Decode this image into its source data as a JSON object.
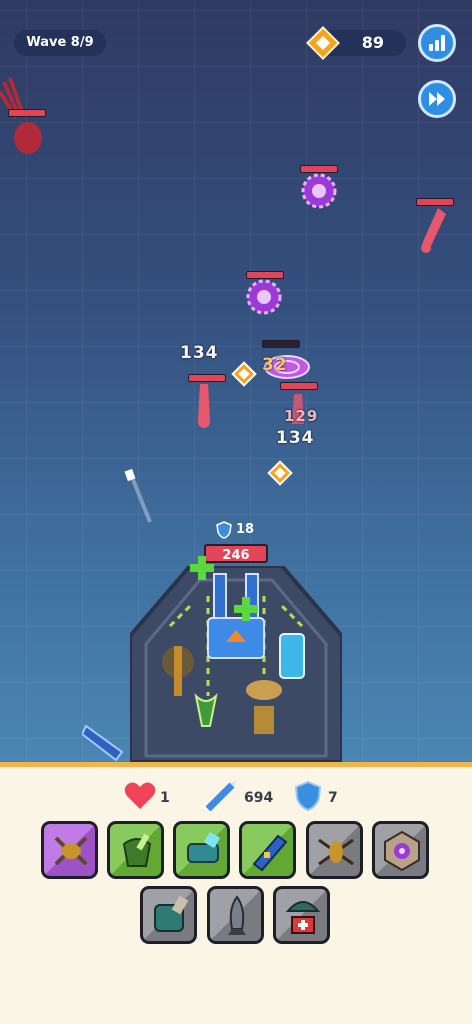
{
  "hud": {
    "wave_label": "Wave 8/9",
    "coins": "89",
    "stats_icon": "bar-chart-icon",
    "fast_forward_icon": "fast-forward-icon"
  },
  "damage_numbers": [
    "134",
    "32",
    "129",
    "134"
  ],
  "base": {
    "shield": "18",
    "hp": "246"
  },
  "resources": {
    "lives": "1",
    "ammo": "694",
    "shields": "7"
  },
  "unit_cards_row1": [
    {
      "name": "spider-mech",
      "tier": "purple"
    },
    {
      "name": "green-tank",
      "tier": "green"
    },
    {
      "name": "teal-turret",
      "tier": "green"
    },
    {
      "name": "blue-missile",
      "tier": "green"
    },
    {
      "name": "helicopter",
      "tier": "gray"
    },
    {
      "name": "vortex-turret",
      "tier": "gray"
    }
  ],
  "unit_cards_row2": [
    {
      "name": "cannon-turret",
      "tier": "gray"
    },
    {
      "name": "bomb",
      "tier": "gray"
    },
    {
      "name": "medic-drop",
      "tier": "gray"
    }
  ],
  "colors": {
    "accent_blue": "#2f8de4",
    "hp_red": "#e04558",
    "panel_bg": "#fbf5e6",
    "panel_border": "#f2b54c",
    "coin_orange": "#f7a21c"
  }
}
